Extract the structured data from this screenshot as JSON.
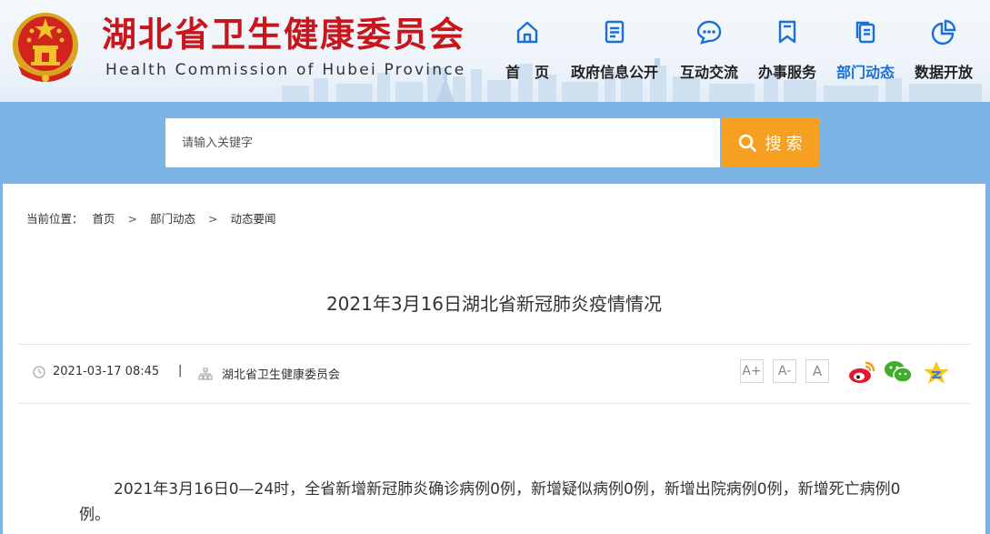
{
  "header": {
    "title_cn": "湖北省卫生健康委员会",
    "title_en": "Health Commission of Hubei Province"
  },
  "nav": {
    "items": [
      {
        "label": "首　页",
        "icon": "home-icon"
      },
      {
        "label": "政府信息公开",
        "icon": "document-icon"
      },
      {
        "label": "互动交流",
        "icon": "chat-icon"
      },
      {
        "label": "办事服务",
        "icon": "bookmark-icon"
      },
      {
        "label": "部门动态",
        "icon": "pages-icon",
        "active": true
      },
      {
        "label": "数据开放",
        "icon": "pie-chart-icon"
      }
    ],
    "active_color": "#1a6fd8"
  },
  "search": {
    "placeholder": "请输入关键字",
    "button_label": "搜 索",
    "button_color": "#f5a021"
  },
  "breadcrumb": {
    "prefix": "当前位置：",
    "items": [
      "首页",
      "部门动态",
      "动态要闻"
    ],
    "separator": ">"
  },
  "article": {
    "title": "2021年3月16日湖北省新冠肺炎疫情情况",
    "date": "2021-03-17 08:45",
    "divider": "|",
    "source": "湖北省卫生健康委员会",
    "font_controls": [
      "A+",
      "A-",
      "A"
    ],
    "share": [
      "weibo-icon",
      "wechat-icon",
      "qzone-icon"
    ],
    "body": "2021年3月16日0—24时，全省新增新冠肺炎确诊病例0例，新增疑似病例0例，新增出院病例0例，新增死亡病例0例。"
  },
  "colors": {
    "brand_red": "#c8161d",
    "band_blue": "#7db4e6"
  }
}
